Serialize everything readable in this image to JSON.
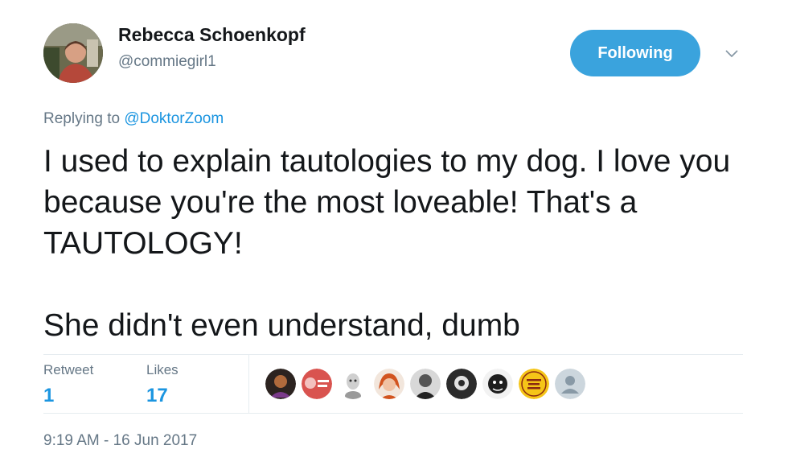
{
  "author": {
    "display_name": "Rebecca Schoenkopf",
    "handle": "@commiegirl1",
    "avatar_icon": "user-avatar-photo"
  },
  "follow_button": {
    "label": "Following",
    "color": "#3aa3dd"
  },
  "menu_caret_icon": "chevron-down-icon",
  "reply": {
    "prefix": "Replying to",
    "mention": "@DoktorZoom"
  },
  "tweet_text": "I used to explain tautologies to my dog. I love you because you're the most loveable! That's a TAUTOLOGY!\n\nShe didn't even understand, dumb",
  "stats": {
    "retweet_label": "Retweet",
    "retweet_count": "1",
    "likes_label": "Likes",
    "likes_count": "17"
  },
  "likers": [
    {
      "icon": "liker-avatar-1"
    },
    {
      "icon": "liker-avatar-2"
    },
    {
      "icon": "liker-avatar-3"
    },
    {
      "icon": "liker-avatar-4"
    },
    {
      "icon": "liker-avatar-5"
    },
    {
      "icon": "liker-avatar-6"
    },
    {
      "icon": "liker-avatar-7"
    },
    {
      "icon": "liker-avatar-8"
    },
    {
      "icon": "liker-avatar-default"
    }
  ],
  "timestamp": "9:19 AM - 16 Jun 2017",
  "colors": {
    "link": "#1b95e0",
    "secondary_text": "#657786",
    "divider": "#e6ecf0"
  }
}
